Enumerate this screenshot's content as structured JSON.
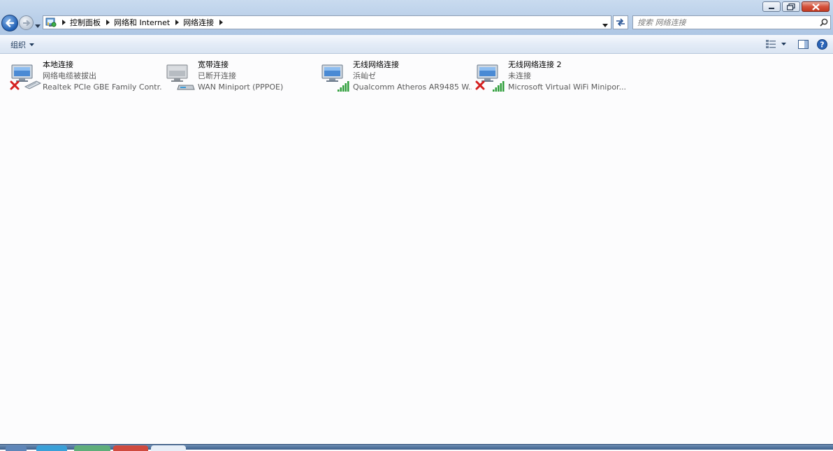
{
  "window": {
    "controls": {
      "minimize": "minimize",
      "maximize": "maximize",
      "close": "close"
    }
  },
  "address_bar": {
    "breadcrumbs": [
      "控制面板",
      "网络和 Internet",
      "网络连接"
    ]
  },
  "search": {
    "placeholder": "搜索 网络连接",
    "value": ""
  },
  "command_bar": {
    "organize_label": "组织"
  },
  "connections": [
    {
      "name": "本地连接",
      "status": "网络电缆被拔出",
      "device": "Realtek PCIe GBE Family Contr...",
      "type": "ethernet",
      "disconnected": true
    },
    {
      "name": "宽带连接",
      "status": "已断开连接",
      "device": "WAN Miniport (PPPOE)",
      "type": "broadband",
      "disconnected": false
    },
    {
      "name": "无线网络连接",
      "status": "浜屾ゼ",
      "device": "Qualcomm Atheros AR9485 W...",
      "type": "wireless",
      "disconnected": false
    },
    {
      "name": "无线网络连接 2",
      "status": "未连接",
      "device": "Microsoft Virtual WiFi Minipor...",
      "type": "wireless",
      "disconnected": true
    }
  ],
  "colors": {
    "accent": "#1e395b",
    "error_x": "#d42020",
    "signal_green": "#2e9e3a"
  }
}
